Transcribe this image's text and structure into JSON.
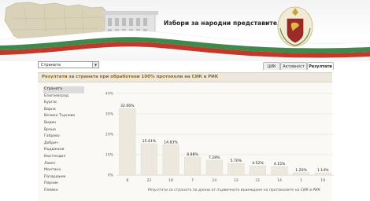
{
  "header": {
    "title": "Избори за народни представители 2014"
  },
  "colors": {
    "flag_white": "#ffffff",
    "flag_green": "#3f8a4b",
    "flag_red": "#c0392b",
    "map": "#d9d2b8",
    "panel_title": "#8a6a2a",
    "bar": "#ece8dd"
  },
  "toolbar": {
    "region_select": {
      "value": "Страната"
    },
    "tabs": [
      {
        "label": "ЦИК"
      },
      {
        "label": "Активност"
      },
      {
        "label": "Резултати",
        "active": true
      }
    ]
  },
  "panel": {
    "title": "Резултати за страната при обработени 100% протоколи на СИК в РИК"
  },
  "regions": [
    "Страната",
    "Благоевград",
    "Бургас",
    "Варна",
    "Велико Търново",
    "Видин",
    "Враца",
    "Габрово",
    "Добрич",
    "Кърджали",
    "Кюстендил",
    "Ловеч",
    "Монтана",
    "Пазарджик",
    "Перник",
    "Плевен"
  ],
  "chart_data": {
    "type": "bar",
    "categories": [
      "8",
      "22",
      "18",
      "7",
      "24",
      "13",
      "11",
      "14",
      "1",
      "19"
    ],
    "values": [
      32.66,
      15.41,
      14.83,
      8.88,
      7.28,
      5.7,
      4.52,
      4.15,
      1.2,
      1.14
    ],
    "value_labels": [
      "32.66%",
      "15.41%",
      "14.83%",
      "8.88%",
      "7.28%",
      "5.70%",
      "4.52%",
      "4.15%",
      "1.20%",
      "1.14%"
    ],
    "ylim": [
      0,
      40
    ],
    "yticks": [
      "0%",
      "10%",
      "20%",
      "30%",
      "40%"
    ],
    "grid": true,
    "caption": "Резултати за страната по данни от първичното въвеждане на протоколите на СИК в РИК"
  }
}
